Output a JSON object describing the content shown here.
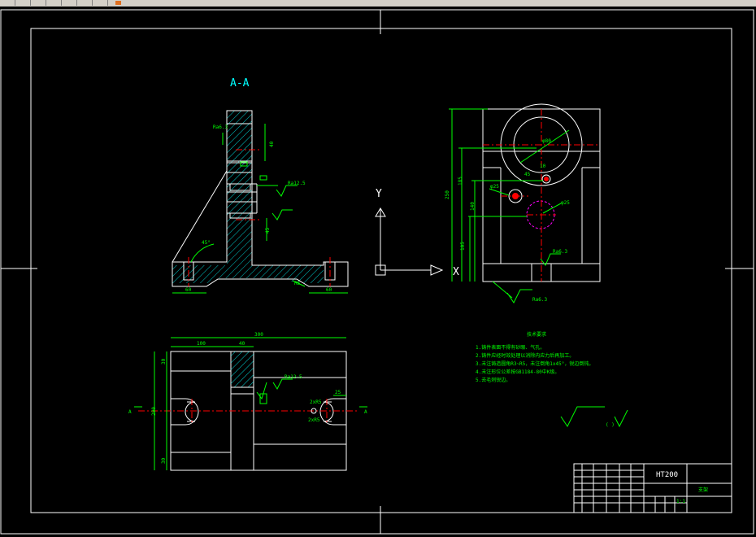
{
  "drawing": {
    "section_label": "A-A",
    "axis_y_label": "Y",
    "axis_x_label": "X",
    "colors": {
      "background": "#000000",
      "outline": "#ffffff",
      "dimension": "#00ff00",
      "center": "#ff0000",
      "hatch": "#00ffff",
      "hidden": "#ff00ff"
    },
    "dims_front": {
      "top_rough": "Ra6.3",
      "d1": "40",
      "d2": "45",
      "d3": "Ra12.5",
      "angle": "45°",
      "left_w": "60",
      "right_w": "60",
      "r": "R5"
    },
    "dims_top": {
      "overall": "300",
      "left": "100",
      "mid": "40",
      "top_h": "30",
      "height": "200",
      "bottom_h": "30",
      "right_w": "25",
      "r1": "2xR5",
      "r2": "2xR5",
      "sec_left": "A",
      "sec_right": "A"
    },
    "dims_side": {
      "height_total": "250",
      "h1": "185",
      "h2": "140",
      "h3": "105",
      "hole1": "φ25",
      "hole2": "φ25",
      "circle": "φ80",
      "gap": "10",
      "w": "45",
      "rough": "Ra6.3"
    },
    "notes": {
      "title": "技术要求",
      "lines": [
        "1.铸件表面不得有砂眼、气孔。",
        "2.铸件应经时效处理以消除内应力后再加工。",
        "3.未注铸造圆角R3~R5，未注倒角1x45°，锐边倒钝。",
        "4.未注形位公差按GB1184-80中K级。",
        "5.去毛刺锐边。"
      ]
    },
    "roughness_other": "(  )",
    "title_block": {
      "material": "HT200",
      "name": "支架",
      "scale": "1:1"
    }
  }
}
